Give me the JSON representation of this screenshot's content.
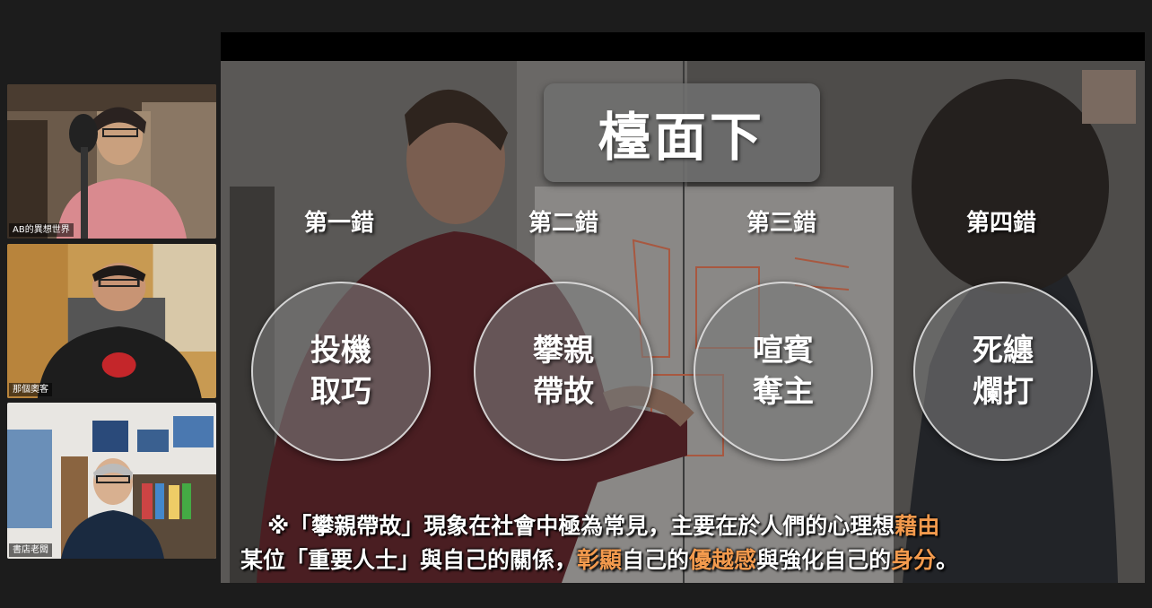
{
  "participants": [
    {
      "name": "AB的異想世界"
    },
    {
      "name": "那個奧客"
    },
    {
      "name": "書店老闆"
    }
  ],
  "slide": {
    "title": "檯面下",
    "mistakes": [
      {
        "label": "第一錯",
        "text": "投機\n取巧"
      },
      {
        "label": "第二錯",
        "text": "攀親\n帶故"
      },
      {
        "label": "第三錯",
        "text": "喧賓\n奪主"
      },
      {
        "label": "第四錯",
        "text": "死纏\n爛打"
      }
    ],
    "caption": {
      "line1": {
        "part1": "※「攀親帶故」現象在社會中極為常見，主要在於人們的心理想",
        "hl1": "藉由"
      },
      "line2": {
        "part1": "某位「重要人士」與自己的關係，",
        "hl1": "彰顯",
        "part2": "自己的",
        "hl2": "優越感",
        "part3": "與強化自己的",
        "hl3": "身分",
        "part4": "。"
      }
    }
  },
  "colors": {
    "highlight": "#f39a4d",
    "background": "#1c1c1c"
  }
}
